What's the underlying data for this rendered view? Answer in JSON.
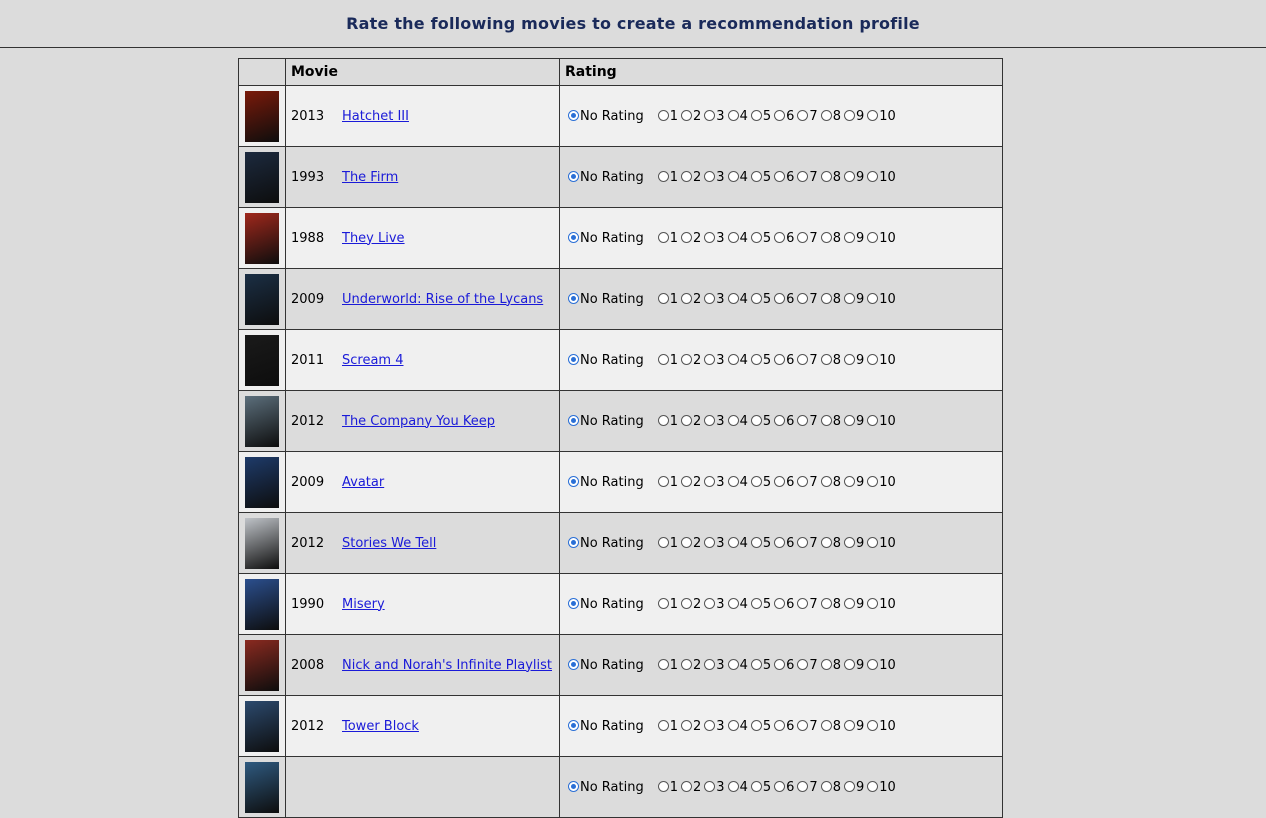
{
  "header": {
    "title": "Rate the following movies to create a recommendation profile"
  },
  "table": {
    "col_movie": "Movie",
    "col_rating": "Rating"
  },
  "rating_options": [
    "No Rating",
    "1",
    "2",
    "3",
    "4",
    "5",
    "6",
    "7",
    "8",
    "9",
    "10"
  ],
  "selected_option": "No Rating",
  "movies": [
    {
      "year": "2013",
      "title": "Hatchet III",
      "poster_color": "#7a1a0a"
    },
    {
      "year": "1993",
      "title": "The Firm",
      "poster_color": "#1c2a3e"
    },
    {
      "year": "1988",
      "title": "They Live",
      "poster_color": "#a0281c"
    },
    {
      "year": "2009",
      "title": "Underworld: Rise of the Lycans",
      "poster_color": "#1b2f45"
    },
    {
      "year": "2011",
      "title": "Scream 4",
      "poster_color": "#1a1a1a"
    },
    {
      "year": "2012",
      "title": "The Company You Keep",
      "poster_color": "#5c6f7c"
    },
    {
      "year": "2009",
      "title": "Avatar",
      "poster_color": "#1e3b6a"
    },
    {
      "year": "2012",
      "title": "Stories We Tell",
      "poster_color": "#bfc3c8"
    },
    {
      "year": "1990",
      "title": "Misery",
      "poster_color": "#2b4f8e"
    },
    {
      "year": "2008",
      "title": "Nick and Norah's Infinite Playlist",
      "poster_color": "#8a2a20"
    },
    {
      "year": "2012",
      "title": "Tower Block",
      "poster_color": "#2c4a6e"
    },
    {
      "year": "",
      "title": "",
      "poster_color": "#2f5a80"
    }
  ]
}
